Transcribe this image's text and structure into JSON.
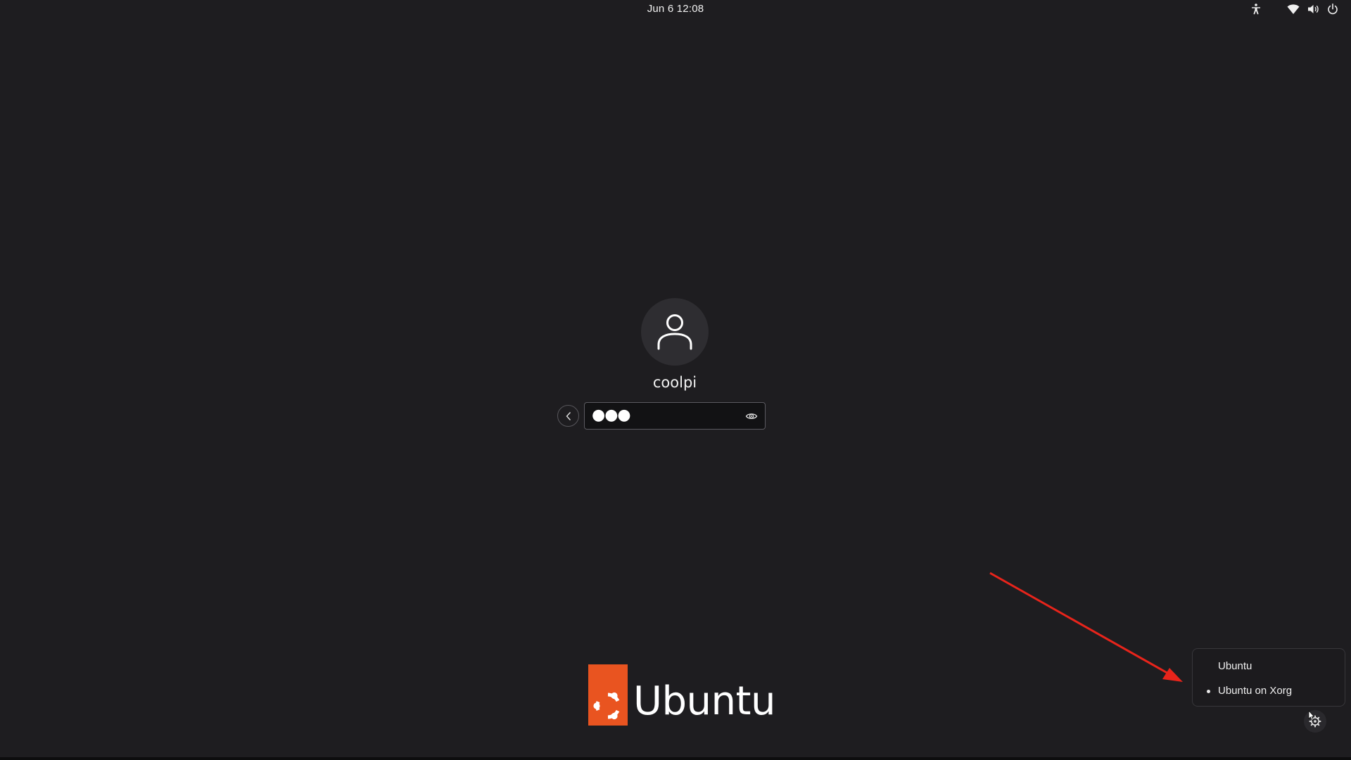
{
  "topbar": {
    "clock": "Jun 6  12:08",
    "icons": [
      "accessibility-icon",
      "network-wifi-icon",
      "volume-icon",
      "power-icon"
    ]
  },
  "login": {
    "username": "coolpi",
    "password_masked": "●●●",
    "avatar_icon": "user-avatar-icon",
    "back_icon": "chevron-left-icon",
    "reveal_icon": "eye-icon"
  },
  "branding": {
    "name": "Ubuntu",
    "accent_color": "#e95420"
  },
  "session_menu": {
    "items": [
      {
        "label": "Ubuntu",
        "selected": false
      },
      {
        "label": "Ubuntu on Xorg",
        "selected": true
      }
    ],
    "button_icon": "gear-icon"
  },
  "annotation": {
    "arrow_color": "#e8241b"
  }
}
